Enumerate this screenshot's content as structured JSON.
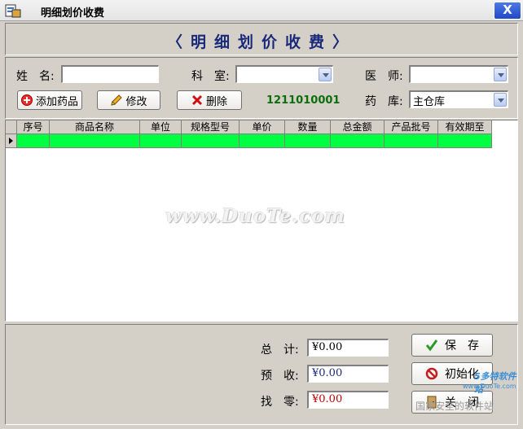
{
  "window": {
    "title": "明细划价收费",
    "close_label": "X"
  },
  "header": {
    "title": "〈明细划价收费〉"
  },
  "form": {
    "name_label": "姓",
    "name_label2": "名:",
    "name_value": "",
    "dept_label": "科",
    "dept_label2": "室:",
    "dept_value": "",
    "doctor_label": "医",
    "doctor_label2": "师:",
    "doctor_value": "",
    "pharmacy_label": "药",
    "pharmacy_label2": "库:",
    "pharmacy_value": "主仓库",
    "code": "1211010001"
  },
  "toolbar": {
    "add_label": "添加药品",
    "edit_label": "修改",
    "delete_label": "删除"
  },
  "grid": {
    "columns": [
      "序号",
      "商品名称",
      "单位",
      "规格型号",
      "单价",
      "数量",
      "总金额",
      "产品批号",
      "有效期至"
    ],
    "rows": [
      [
        "",
        "",
        "",
        "",
        "",
        "",
        "",
        "",
        ""
      ]
    ]
  },
  "watermark": "www.DuoTe.com",
  "footer": {
    "total_label": "总",
    "total_label2": "计:",
    "total_value": "¥0.00",
    "received_label": "预",
    "received_label2": "收:",
    "received_value": "¥0.00",
    "change_label": "找",
    "change_label2": "零:",
    "change_value": "¥0.00",
    "save_label": "保　存",
    "init_label": "初始化",
    "close_label": "关　闭"
  },
  "corner": {
    "logo": "5多特软件站",
    "sub": "www.DuoTe.com",
    "mark": "国家安全的软件站"
  },
  "colors": {
    "grid_row": "#00ff40",
    "code_text": "#0a6e0a",
    "total_value": "#000000",
    "received_value": "#1a2a7a",
    "change_value": "#c00000"
  }
}
